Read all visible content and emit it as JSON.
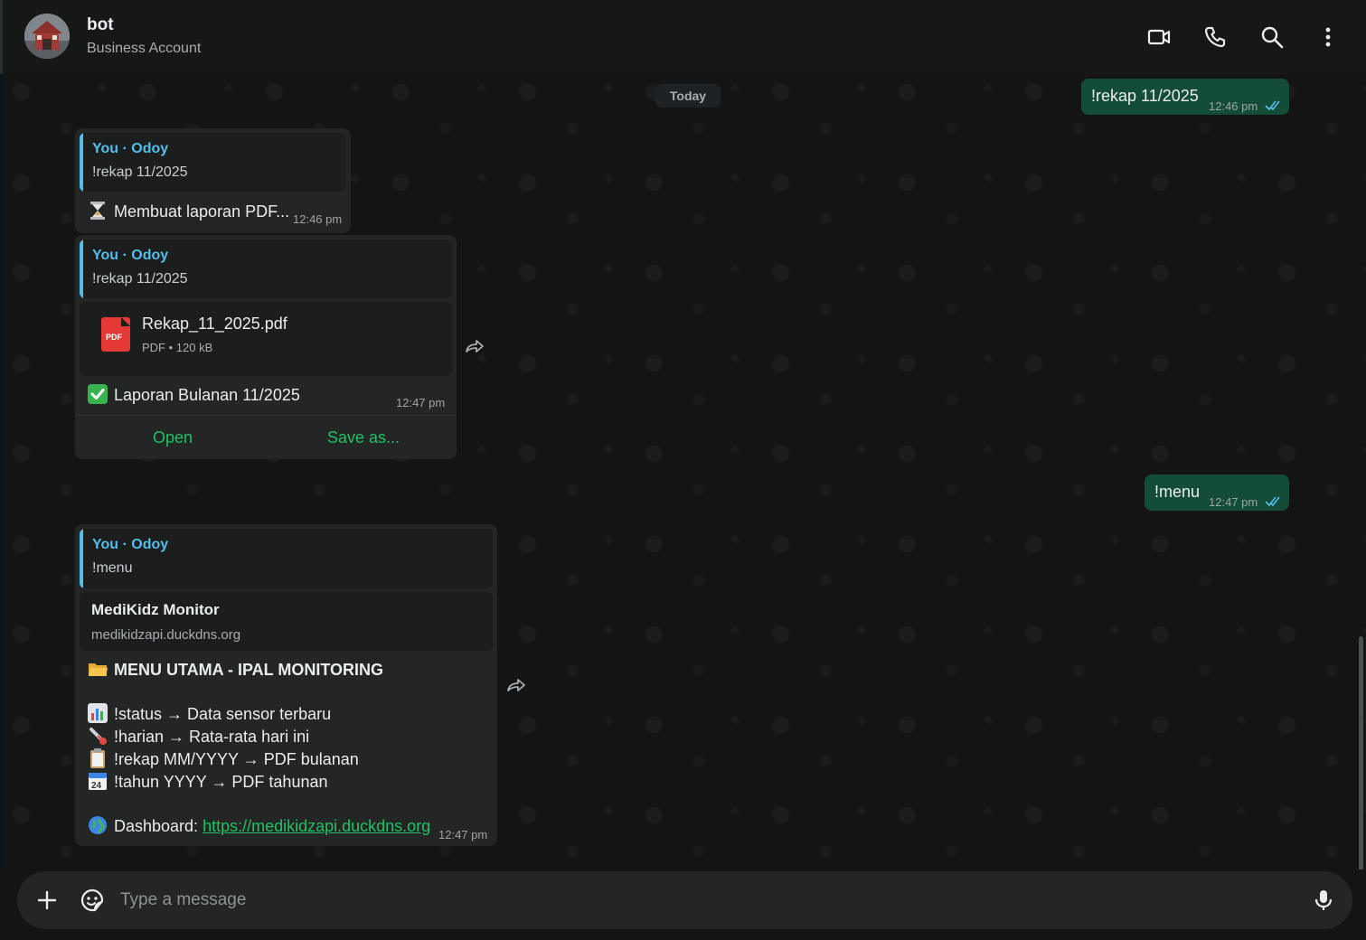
{
  "header": {
    "contact_name": "bot",
    "contact_status": "Business Account",
    "icons": [
      "video-call-icon",
      "voice-call-icon",
      "search-icon",
      "more-options-icon"
    ]
  },
  "chat": {
    "date_chip": "Today",
    "messages": [
      {
        "direction": "out",
        "text": "!rekap 11/2025",
        "time": "12:46 pm",
        "status": "read"
      },
      {
        "direction": "in",
        "quote_author": "You · Odoy",
        "quote_text": "!rekap 11/2025",
        "emoji": "hourglass",
        "text": "Membuat laporan PDF...",
        "time": "12:46 pm"
      },
      {
        "direction": "in",
        "quote_author": "You · Odoy",
        "quote_text": "!rekap 11/2025",
        "document": {
          "file_name": "Rekap_11_2025.pdf",
          "file_type_label": "PDF",
          "file_meta": "PDF • 120 kB"
        },
        "emoji": "check-mark-button",
        "text": "Laporan Bulanan 11/2025",
        "time": "12:47 pm",
        "buttons": [
          "Open",
          "Save as..."
        ]
      },
      {
        "direction": "out",
        "text": "!menu",
        "time": "12:47 pm",
        "status": "read"
      },
      {
        "direction": "in",
        "quote_author": "You · Odoy",
        "quote_text": "!menu",
        "link_preview": {
          "title": "MediKidz Monitor",
          "domain": "medikidzapi.duckdns.org"
        },
        "heading": "MENU UTAMA - IPAL MONITORING",
        "lines": [
          "!status → Data sensor terbaru",
          "!harian → Rata-rata hari ini",
          "!rekap MM/YYYY → PDF bulanan",
          "!tahun YYYY → PDF tahunan"
        ],
        "dashboard_label": "Dashboard: ",
        "dashboard_url": "https://medikidzapi.duckdns.org",
        "time": "12:47 pm"
      }
    ]
  },
  "composer": {
    "placeholder": "Type a message"
  },
  "colors": {
    "outgoing_bubble": "#144d37",
    "incoming_bubble": "#242626",
    "accent_green": "#21c063",
    "quote_blue": "#53bdeb",
    "read_ticks": "#53bdeb"
  }
}
